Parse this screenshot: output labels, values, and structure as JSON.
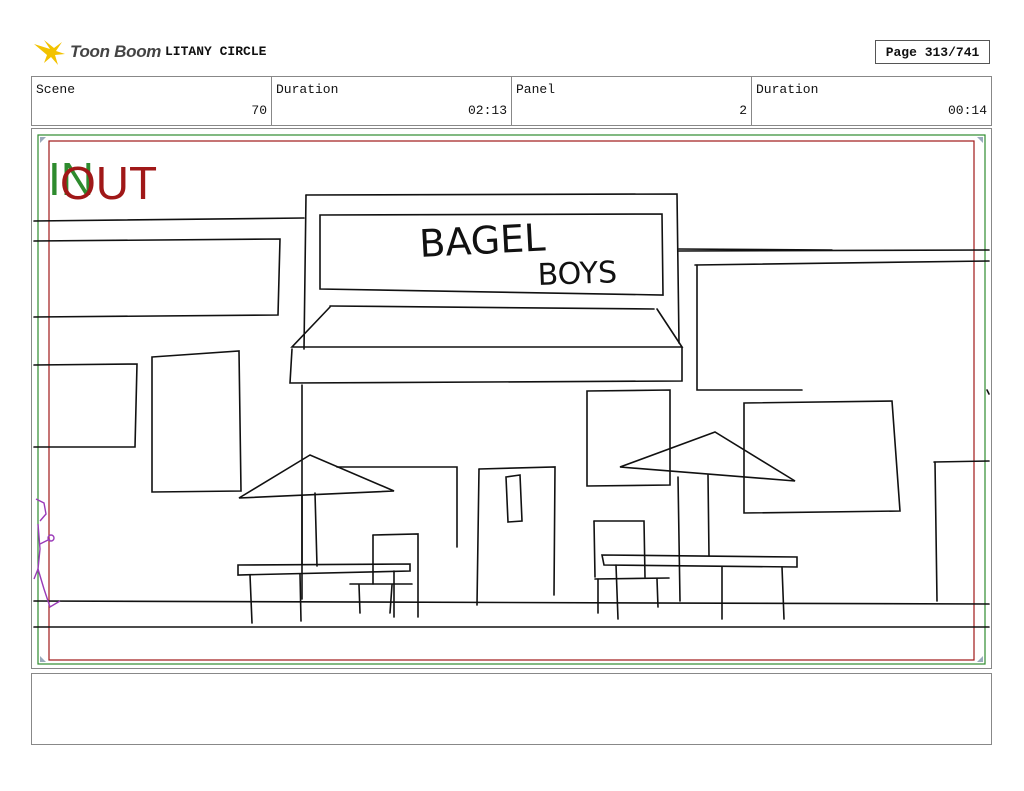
{
  "header": {
    "brand": "Toon Boom",
    "project_title": "LITANY CIRCLE",
    "page_label": "Page 313/741"
  },
  "info": {
    "scene_label": "Scene",
    "scene_value": "70",
    "scene_duration_label": "Duration",
    "scene_duration_value": "02:13",
    "panel_label": "Panel",
    "panel_value": "2",
    "panel_duration_label": "Duration",
    "panel_duration_value": "00:14"
  },
  "panel": {
    "in_label": "IN",
    "out_label": "OUT",
    "sign_line1": "BAGEL",
    "sign_line2": "BOYS",
    "in_color": "#2e8b2e",
    "out_color": "#a01818"
  },
  "notes": {
    "text": ""
  }
}
